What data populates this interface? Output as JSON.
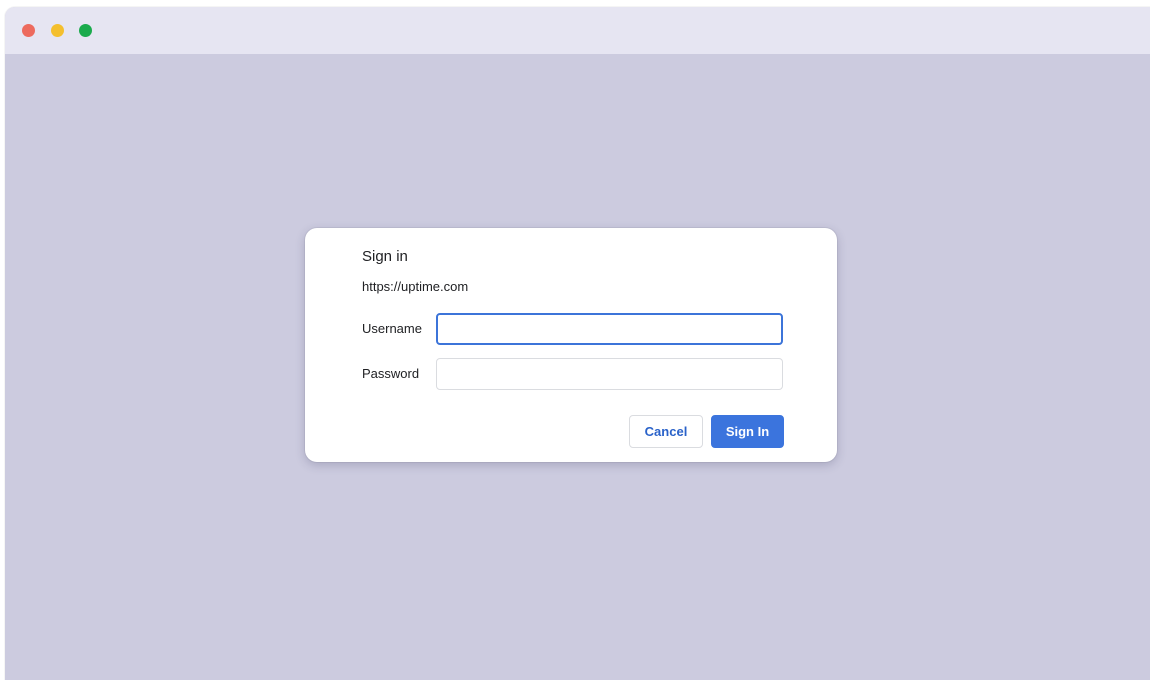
{
  "window": {
    "controls": [
      "close",
      "minimize",
      "zoom"
    ],
    "colors": {
      "close": "#ed6a5e",
      "minimize": "#f4bf2e",
      "zoom": "#1bab4d",
      "background": "#cccbdf",
      "titlebar": "#e6e5f2"
    }
  },
  "dialog": {
    "title": "Sign in",
    "origin": "https://uptime.com",
    "username": {
      "label": "Username",
      "value": "",
      "placeholder": ""
    },
    "password": {
      "label": "Password",
      "value": "",
      "placeholder": ""
    },
    "cancel_label": "Cancel",
    "signin_label": "Sign In",
    "accent_color": "#3b74dd"
  }
}
